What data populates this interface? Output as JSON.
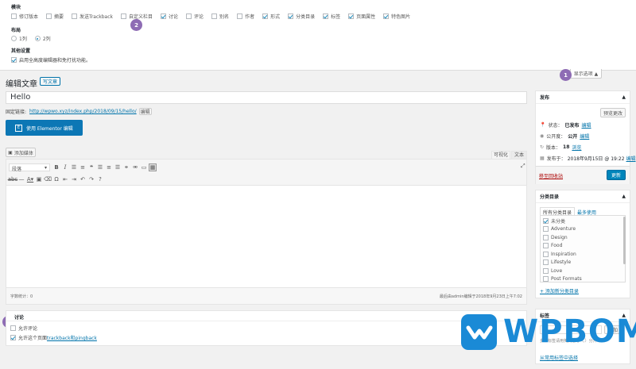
{
  "screen_options": {
    "modules_heading": "模块",
    "modules": [
      {
        "label": "修订版本",
        "checked": false
      },
      {
        "label": "摘要",
        "checked": false
      },
      {
        "label": "发送Trackback",
        "checked": false
      },
      {
        "label": "自定义栏目",
        "checked": false
      },
      {
        "label": "讨论",
        "checked": true
      },
      {
        "label": "评论",
        "checked": false
      },
      {
        "label": "别名",
        "checked": false
      },
      {
        "label": "作者",
        "checked": false
      },
      {
        "label": "形式",
        "checked": true
      },
      {
        "label": "分类目录",
        "checked": true
      },
      {
        "label": "标签",
        "checked": true
      },
      {
        "label": "页面属性",
        "checked": true
      },
      {
        "label": "特色图片",
        "checked": true
      }
    ],
    "layout_heading": "布局",
    "layout_one": "1列",
    "layout_two": "2列",
    "other_heading": "其他设置",
    "fullscreen_label": "启用全高度编辑器和免打扰功能。",
    "toggle_label": "显示选项 ▲"
  },
  "badges": {
    "b1": "1",
    "b2": "2",
    "b3": "3"
  },
  "page": {
    "title": "编辑文章",
    "add_new": "写文章",
    "post_title": "Hello",
    "permalink_label": "固定链接:",
    "permalink_url": "http://wpwo.xyz/index.php/2018/09/15/hello/",
    "permalink_edit": "编辑",
    "elementor_label": "使用 Elementor 编辑",
    "elementor_icon": "E",
    "add_media": "添加媒体",
    "tab_visual": "可视化",
    "tab_text": "文本",
    "format_select": "段落",
    "word_count": "字数统计：0",
    "last_edit": "最后由admin编辑于2018年9月23日上午7:02"
  },
  "discussion": {
    "title": "讨论",
    "allow_comments": "允许评论",
    "trackback_prefix": "允许这个页面",
    "trackback_link": "trackback和pingback"
  },
  "publish": {
    "title": "发布",
    "preview": "预览更改",
    "status_label": "状态：",
    "status_value": "已发布",
    "visibility_label": "公开度：",
    "visibility_value": "公开",
    "revisions_label": "版本：",
    "revisions_value": "18",
    "revisions_link": "浏览",
    "published_label": "发布于：",
    "published_value": "2018年9月15日 @ 19:22",
    "edit": "编辑",
    "trash": "移至回收站",
    "update": "更新"
  },
  "categories": {
    "title": "分类目录",
    "tab_all": "所有分类目录",
    "tab_popular": "最多使用",
    "items": [
      {
        "label": "未分类",
        "checked": true
      },
      {
        "label": "Adventure",
        "checked": false
      },
      {
        "label": "Design",
        "checked": false
      },
      {
        "label": "Food",
        "checked": false
      },
      {
        "label": "Inspiration",
        "checked": false
      },
      {
        "label": "Lifestyle",
        "checked": false
      },
      {
        "label": "Love",
        "checked": false
      },
      {
        "label": "Post Formats",
        "checked": false
      }
    ],
    "add_new": "+ 添加新分类目录"
  },
  "tags": {
    "title": "标签",
    "add_button": "添加",
    "hint": "多个标签请用英文逗号（,）分开",
    "choose": "从常用标签中选择"
  },
  "watermark": {
    "text": "WPBOM",
    "brand_color": "#1a8ad6"
  },
  "colors": {
    "accent": "#0073aa",
    "badge": "#8e6cb4",
    "primary_button": "#0085ba",
    "elementor": "#0c77b5"
  }
}
